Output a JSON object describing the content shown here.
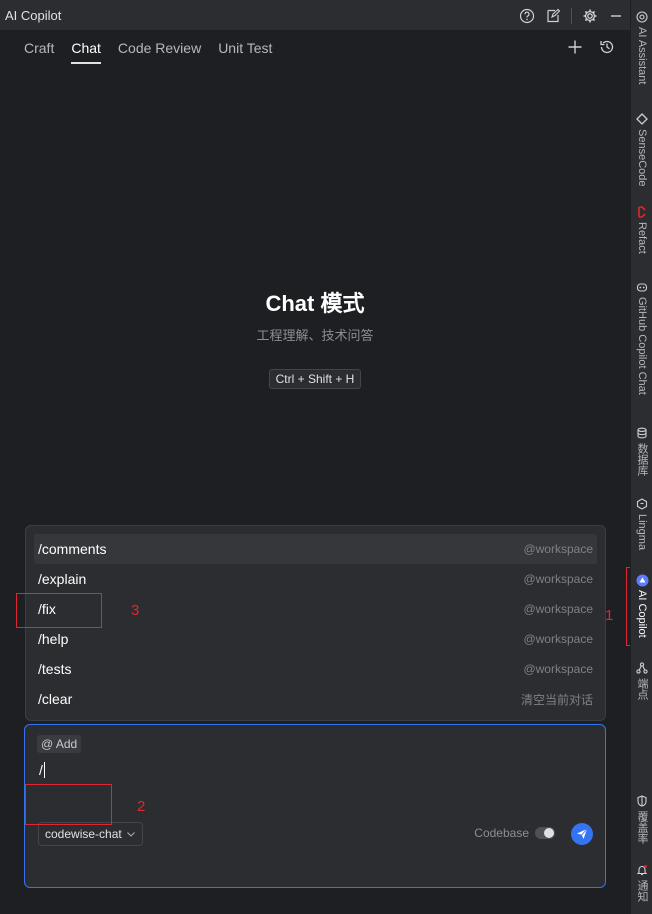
{
  "window": {
    "title": "AI Copilot"
  },
  "tabs": [
    {
      "label": "Craft",
      "active": false
    },
    {
      "label": "Chat",
      "active": true
    },
    {
      "label": "Code Review",
      "active": false
    },
    {
      "label": "Unit Test",
      "active": false
    }
  ],
  "hero": {
    "title": "Chat 模式",
    "subtitle": "工程理解、技术问答",
    "shortcut": "Ctrl + Shift + H"
  },
  "commands": [
    {
      "name": "/comments",
      "scope": "@workspace"
    },
    {
      "name": "/explain",
      "scope": "@workspace"
    },
    {
      "name": "/fix",
      "scope": "@workspace"
    },
    {
      "name": "/help",
      "scope": "@workspace"
    },
    {
      "name": "/tests",
      "scope": "@workspace"
    },
    {
      "name": "/clear",
      "scope": "清空当前对话"
    }
  ],
  "input": {
    "add_label": "@ Add",
    "value": "/",
    "model": "codewise-chat",
    "codebase_label": "Codebase",
    "codebase_enabled": false
  },
  "annotations": {
    "one": "1",
    "two": "2",
    "three": "3"
  },
  "sidebar": [
    {
      "label": "AI Assistant",
      "icon": "at-icon"
    },
    {
      "label": "SenseCode",
      "icon": "code-diamond-icon"
    },
    {
      "label": "Refact",
      "icon": "refact-icon"
    },
    {
      "label": "GitHub Copilot Chat",
      "icon": "copilot-icon"
    },
    {
      "label": "数据库",
      "icon": "database-icon"
    },
    {
      "label": "Lingma",
      "icon": "lingma-icon"
    },
    {
      "label": "AI Copilot",
      "icon": "ai-copilot-icon",
      "active": true
    },
    {
      "label": "端点",
      "icon": "endpoints-icon"
    },
    {
      "label": "覆盖率",
      "icon": "shield-icon"
    },
    {
      "label": "通知",
      "icon": "bell-icon"
    }
  ],
  "colors": {
    "accent": "#3574f0",
    "annotation": "#e0262e",
    "background": "#1e1f22",
    "panel": "#2b2d30"
  }
}
